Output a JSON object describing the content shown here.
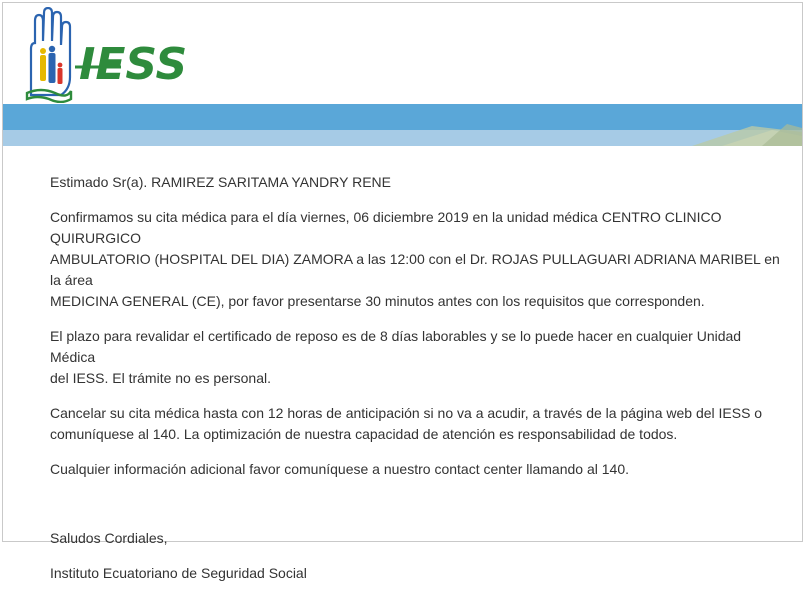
{
  "brand": {
    "logo_text": "IESS",
    "logo_green": "#2e8b3c",
    "logo_blue": "#2b64b0",
    "banner_blue": "#5aa7d8",
    "banner_light": "#a6cbe6"
  },
  "email": {
    "greeting": "Estimado Sr(a). RAMIREZ SARITAMA YANDRY RENE",
    "paragraph1_line1": "Confirmamos su cita médica para el día viernes, 06 diciembre 2019 en la unidad médica CENTRO CLINICO QUIRURGICO",
    "paragraph1_line2": "AMBULATORIO (HOSPITAL DEL DIA) ZAMORA a las 12:00 con el Dr. ROJAS PULLAGUARI ADRIANA MARIBEL en la área",
    "paragraph1_line3": "MEDICINA GENERAL (CE), por favor presentarse 30 minutos antes con los requisitos que corresponden.",
    "paragraph2_line1": "El plazo para revalidar el certificado de reposo es de 8 días laborables y se lo puede hacer en cualquier Unidad Médica",
    "paragraph2_line2": "del IESS. El trámite no es personal.",
    "paragraph3_line1": "Cancelar su cita médica hasta con 12 horas de anticipación si no va a acudir, a través de la página web del IESS o",
    "paragraph3_line2": "comuníquese al 140. La optimización de nuestra capacidad de atención es responsabilidad de todos.",
    "paragraph4": "Cualquier información adicional favor comuníquese a nuestro contact center llamando al 140.",
    "closing": "Saludos Cordiales,",
    "signature": "Instituto Ecuatoriano de Seguridad Social"
  }
}
